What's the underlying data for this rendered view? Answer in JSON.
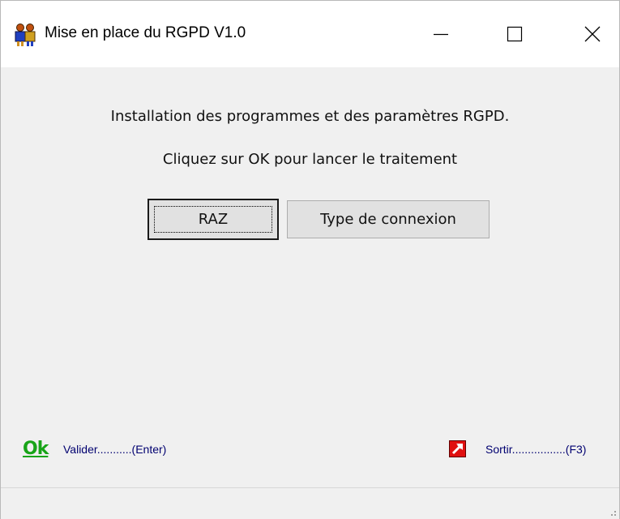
{
  "window": {
    "title": "Mise en place du RGPD V1.0",
    "icon": "users-icon",
    "controls": {
      "minimize": "minimize-icon",
      "maximize": "maximize-icon",
      "close": "close-icon"
    }
  },
  "main": {
    "message_line1": "Installation des programmes et des paramètres RGPD.",
    "message_line2": "Cliquez sur OK pour lancer le traitement"
  },
  "buttons": {
    "raz_label": "RAZ",
    "type_connexion_label": "Type de connexion"
  },
  "footer": {
    "ok_icon_text": "Ok",
    "valider_label": "Valider...........(Enter)",
    "exit_icon": "exit-arrow-icon",
    "sortir_label": "Sortir.................(F3)"
  },
  "colors": {
    "ok_green": "#18a418",
    "footer_text": "#000070",
    "exit_red": "#e01010"
  }
}
